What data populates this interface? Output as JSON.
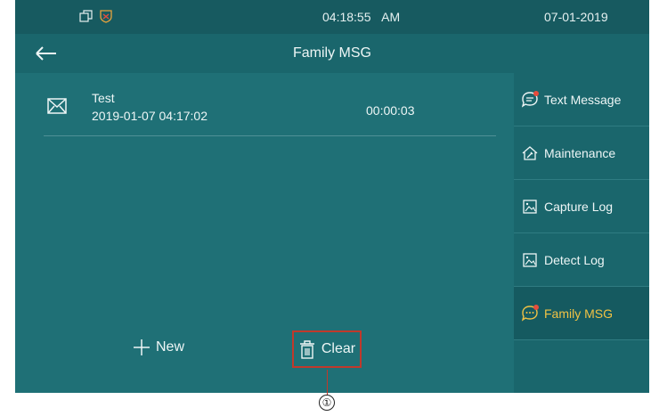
{
  "status_bar": {
    "time": "04:18:55",
    "ampm": "AM",
    "date": "07-01-2019",
    "icons": [
      "window-restore-icon",
      "shield-icon"
    ]
  },
  "header": {
    "title": "Family MSG",
    "back_icon": "back-arrow-icon"
  },
  "messages": [
    {
      "title": "Test",
      "time": "2019-01-07 04:17:02",
      "duration": "00:00:03",
      "icon": "envelope-icon"
    }
  ],
  "actions": {
    "new_label": "New",
    "clear_label": "Clear"
  },
  "sidebar": {
    "items": [
      {
        "label": "Text Message",
        "icon": "chat-bubble-icon",
        "badge": true,
        "active": false
      },
      {
        "label": "Maintenance",
        "icon": "wrench-house-icon",
        "badge": false,
        "active": false
      },
      {
        "label": "Capture Log",
        "icon": "picture-icon",
        "badge": false,
        "active": false
      },
      {
        "label": "Detect Log",
        "icon": "picture-icon",
        "badge": false,
        "active": false
      },
      {
        "label": "Family MSG",
        "icon": "chat-bubble-icon",
        "badge": true,
        "active": true
      }
    ]
  },
  "annotation": {
    "marker": "①"
  },
  "colors": {
    "screen_bg": "#1e6f75",
    "active_text": "#f0c244",
    "highlight_border": "#c0392b",
    "badge": "#e74c3c"
  }
}
